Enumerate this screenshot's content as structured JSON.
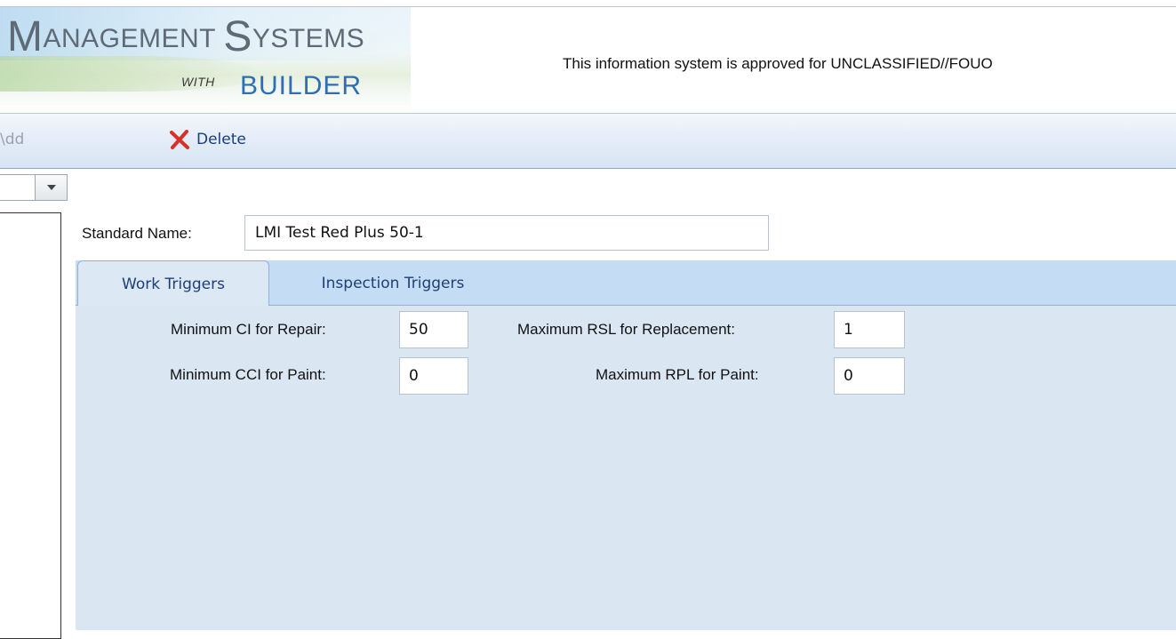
{
  "header": {
    "logo_title_cap1": "M",
    "logo_title_rest1": "ANAGEMENT",
    "logo_title_cap2": "S",
    "logo_title_rest2": "YSTEMS",
    "logo_with": "WITH",
    "logo_builder": "BUILDER",
    "banner": "This information system is approved for UNCLASSIFIED//FOUO"
  },
  "toolbar": {
    "add_label": "\\dd",
    "delete_label": "Delete",
    "delete_icon": "close-icon",
    "delete_color": "#d93025"
  },
  "form": {
    "standard_name_label": "Standard Name:",
    "standard_name_value": "LMI Test Red Plus 50-1"
  },
  "tabs": [
    {
      "label": "Work Triggers",
      "active": true
    },
    {
      "label": "Inspection Triggers",
      "active": false
    }
  ],
  "work_triggers": {
    "min_ci_repair_label": "Minimum CI for Repair:",
    "min_ci_repair_value": "50",
    "min_cci_paint_label": "Minimum CCI for Paint:",
    "min_cci_paint_value": "0",
    "max_rsl_replacement_label": "Maximum RSL for Replacement:",
    "max_rsl_replacement_value": "1",
    "max_rpl_paint_label": "Maximum RPL for Paint:",
    "max_rpl_paint_value": "0"
  },
  "colors": {
    "tab_text": "#1e3f75",
    "tab_bar": "#c5dcf5",
    "panel_bg": "#dbe6f3",
    "builder_blue": "#2b6fb7"
  }
}
